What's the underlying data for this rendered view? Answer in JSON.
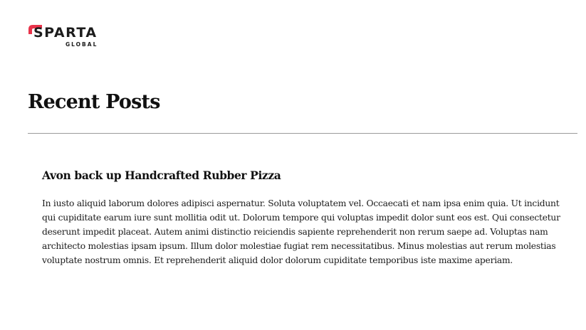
{
  "brand": {
    "name": "SPARTA",
    "tagline": "GLOBAL",
    "accent_color": "#e8334a"
  },
  "page": {
    "title": "Recent Posts"
  },
  "posts": [
    {
      "title": "Avon back up Handcrafted Rubber Pizza",
      "body": "In iusto aliquid laborum dolores adipisci aspernatur. Soluta voluptatem vel. Occaecati et nam ipsa enim quia. Ut incidunt qui cupiditate earum iure sunt mollitia odit ut. Dolorum tempore qui voluptas impedit dolor sunt eos est. Qui consectetur deserunt impedit placeat. Autem animi distinctio reiciendis sapiente reprehenderit non rerum saepe ad. Voluptas nam architecto molestias ipsam ipsum. Illum dolor molestiae fugiat rem necessitatibus. Minus molestias aut rerum molestias voluptate nostrum omnis. Et reprehenderit aliquid dolor dolorum cupiditate temporibus iste maxime aperiam."
    }
  ]
}
